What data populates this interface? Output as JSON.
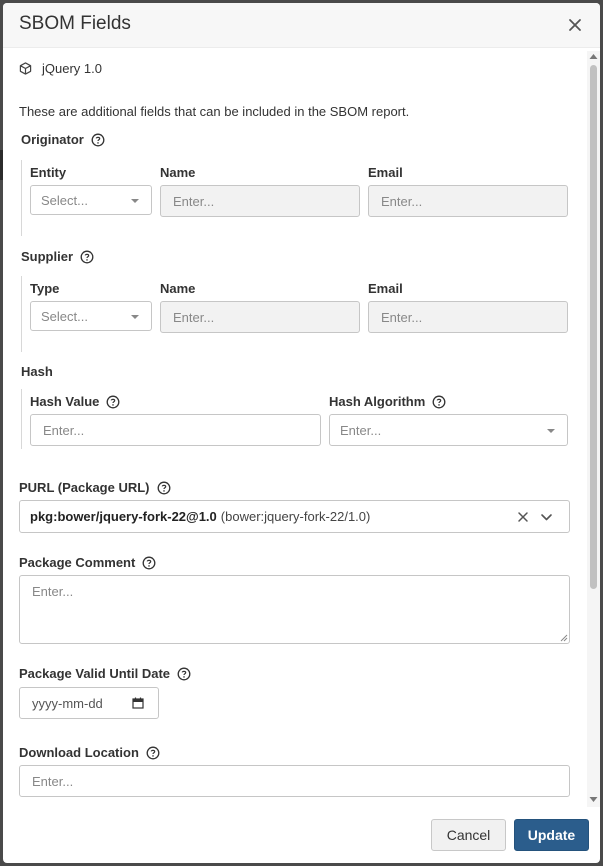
{
  "modal": {
    "title": "SBOM Fields",
    "package_name": "jQuery 1.0",
    "description": "These are additional fields that can be included in the SBOM report."
  },
  "originator": {
    "label": "Originator",
    "entity_label": "Entity",
    "entity_placeholder": "Select...",
    "name_label": "Name",
    "name_placeholder": "Enter...",
    "email_label": "Email",
    "email_placeholder": "Enter..."
  },
  "supplier": {
    "label": "Supplier",
    "type_label": "Type",
    "type_placeholder": "Select...",
    "name_label": "Name",
    "name_placeholder": "Enter...",
    "email_label": "Email",
    "email_placeholder": "Enter..."
  },
  "hash": {
    "label": "Hash",
    "value_label": "Hash Value",
    "value_placeholder": "Enter...",
    "algorithm_label": "Hash Algorithm",
    "algorithm_placeholder": "Enter..."
  },
  "purl": {
    "label": "PURL (Package URL)",
    "value_main": "pkg:bower/jquery-fork-22@1.0",
    "value_sub": "(bower:jquery-fork-22/1.0)"
  },
  "package_comment": {
    "label": "Package Comment",
    "placeholder": "Enter..."
  },
  "valid_until": {
    "label": "Package Valid Until Date",
    "placeholder": "yyyy-mm-dd"
  },
  "download_location": {
    "label": "Download Location",
    "placeholder": "Enter..."
  },
  "footer": {
    "cancel_label": "Cancel",
    "update_label": "Update"
  },
  "colors": {
    "primary": "#2b5d8c",
    "disabled_input": "#f2f2f2"
  }
}
